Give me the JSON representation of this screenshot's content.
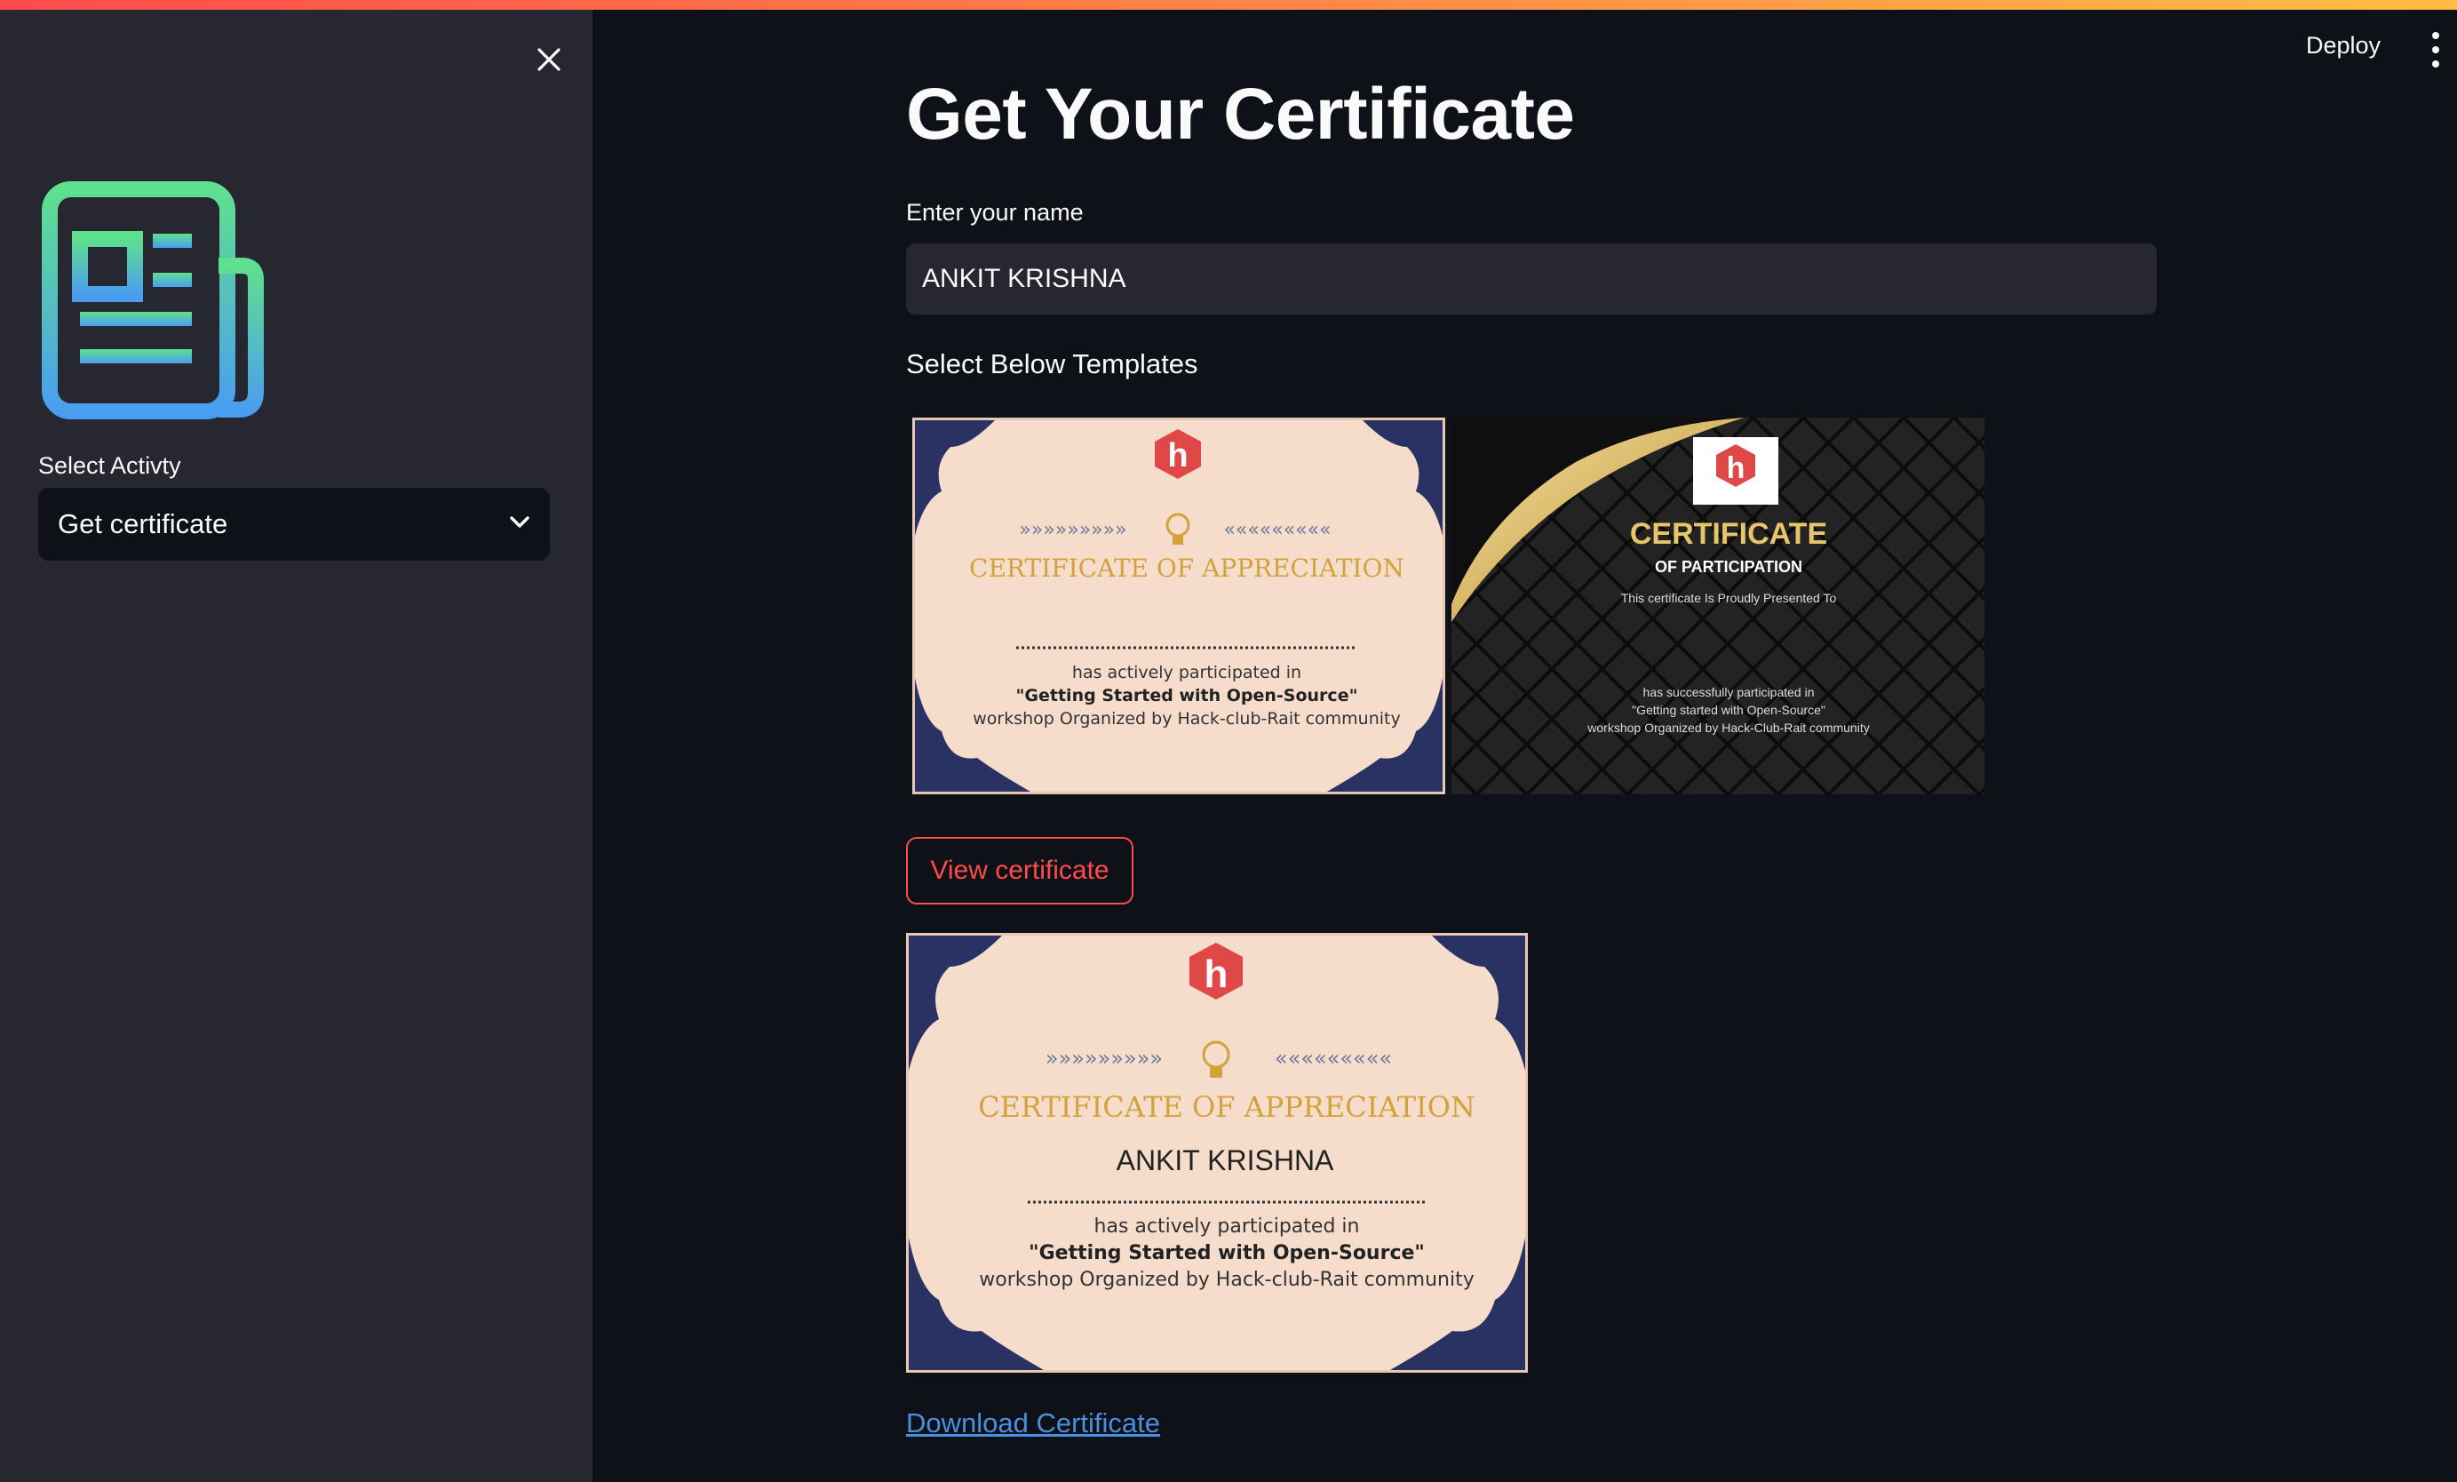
{
  "sidebar": {
    "select_label": "Select Activty",
    "select_value": "Get certificate"
  },
  "header": {
    "deploy_label": "Deploy"
  },
  "main": {
    "title": "Get Your Certificate",
    "name_label": "Enter your name",
    "name_value": "ANKIT KRISHNA",
    "templates_label": "Select Below Templates",
    "view_button": "View certificate",
    "download_link": "Download Certificate"
  },
  "templates": [
    {
      "logo_letter": "h",
      "title": "CERTIFICATE OF APPRECIATION",
      "line1": "has actively participated in",
      "line2": "\"Getting Started with Open-Source\"",
      "line3": "workshop Organized by Hack-club-Rait community",
      "arrows_left": "»»»»»»»»»",
      "arrows_right": "«««««««««"
    },
    {
      "logo_letter": "h",
      "title": "CERTIFICATE",
      "subtitle": "OF PARTICIPATION",
      "presented": "This certificate Is Proudly Presented To",
      "line1": "has successfully participated in",
      "line2": "\"Getting started with Open-Source\"",
      "line3": "workshop Organized by Hack-Club-Rait community"
    }
  ],
  "preview": {
    "logo_letter": "h",
    "title": "CERTIFICATE OF APPRECIATION",
    "name": "ANKIT  KRISHNA",
    "line1": "has actively participated in",
    "line2": "\"Getting Started with Open-Source\"",
    "line3": "workshop Organized by Hack-club-Rait community",
    "arrows_left": "»»»»»»»»»",
    "arrows_right": "«««««««««"
  },
  "colors": {
    "background": "#0e1117",
    "sidebar": "#262730",
    "accent": "#ff4b4b",
    "link": "#4a8fe0",
    "cert_peach": "#f5dccb",
    "cert_navy": "#2a3163",
    "cert_gold": "#d4a23a",
    "logo_red": "#e04848"
  }
}
